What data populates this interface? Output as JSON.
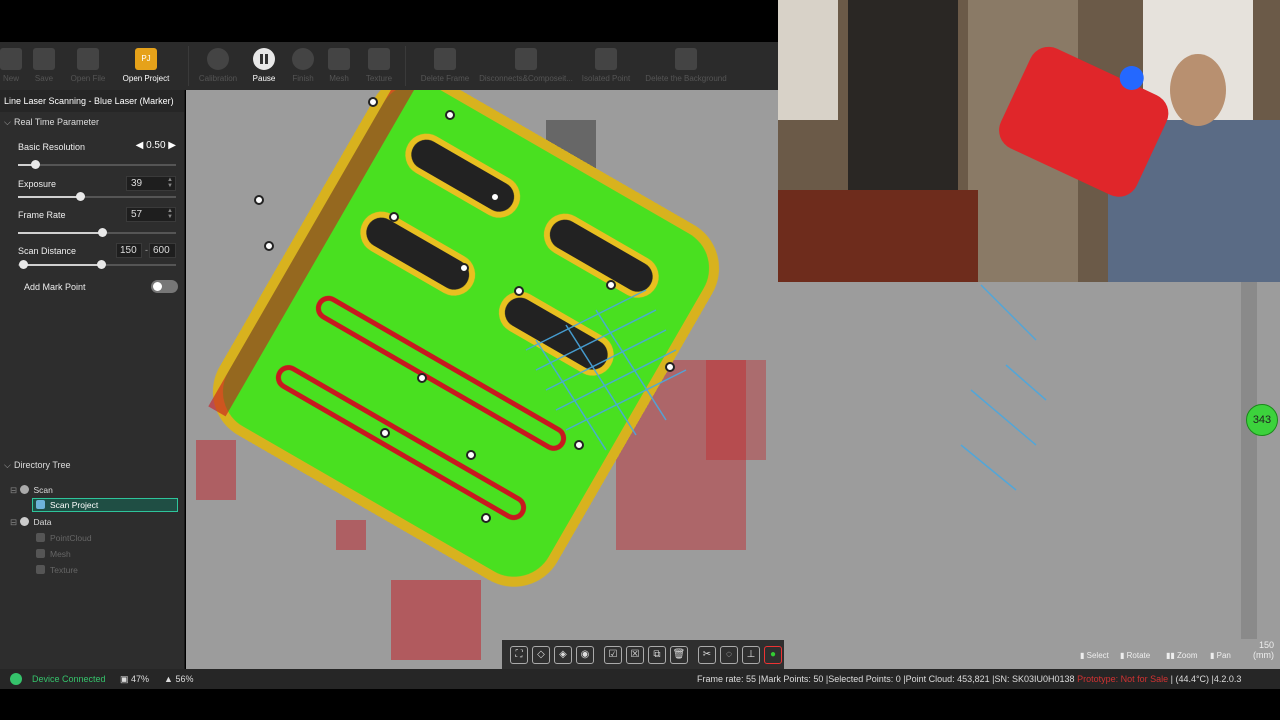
{
  "toolbar": {
    "buttons": [
      {
        "label": "New",
        "icon": "plus-icon"
      },
      {
        "label": "Save",
        "icon": "save-icon"
      },
      {
        "label": "Open File",
        "icon": "file-icon"
      },
      {
        "label": "Open Project",
        "icon": "project-icon",
        "badge": "PJ"
      },
      {
        "label": "Calibration",
        "icon": "target-icon"
      },
      {
        "label": "Pause",
        "icon": "pause-icon"
      },
      {
        "label": "Finish",
        "icon": "stop-icon"
      },
      {
        "label": "Mesh",
        "icon": "mesh-icon"
      },
      {
        "label": "Texture",
        "icon": "texture-icon"
      },
      {
        "label": "Delete Frame",
        "icon": "film-icon"
      },
      {
        "label": "Disconnects&Composeit...",
        "icon": "disconnect-icon"
      },
      {
        "label": "Isolated Point",
        "icon": "isolated-icon"
      },
      {
        "label": "Delete the Background",
        "icon": "background-icon"
      }
    ]
  },
  "panel": {
    "title": "Line Laser Scanning - Blue Laser (Marker)",
    "realtime_header": "Real Time Parameter",
    "basic_resolution": {
      "label": "Basic Resolution",
      "value": "0.50"
    },
    "exposure": {
      "label": "Exposure",
      "value": "39"
    },
    "frame_rate": {
      "label": "Frame Rate",
      "value": "57"
    },
    "scan_distance": {
      "label": "Scan Distance",
      "min": "150",
      "sep": "-",
      "max": "600"
    },
    "mark_point": {
      "label": "Add Mark Point",
      "enabled": false
    },
    "directory_header": "Directory Tree",
    "tree": {
      "scan": "Scan",
      "scan_project": "Scan Project",
      "data": "Data",
      "pointcloud": "PointCloud",
      "mesh": "Mesh",
      "texture": "Texture"
    }
  },
  "viewport": {
    "mouse_legend": {
      "select": "Select",
      "rotate": "Rotate",
      "zoom": "Zoom",
      "pan": "Pan"
    },
    "scale_value": "150",
    "scale_unit": "(mm)",
    "distance_badge": "343"
  },
  "status": {
    "device": "Device Connected",
    "metric1": "47%",
    "metric2": "56%",
    "info": "Frame rate: 55 |Mark Points: 50 |Selected Points: 0 |Point Cloud: 453,821 |SN: SK03IU0H0138 ",
    "warning": "Prototype: Not for Sale",
    "info_tail": " | (44.4°C) |4.2.0.3"
  },
  "colors": {
    "accent_green": "#3cd23c",
    "scan_green": "#49e020",
    "project_orange": "#e6a21a",
    "warning_red": "#d23232"
  }
}
